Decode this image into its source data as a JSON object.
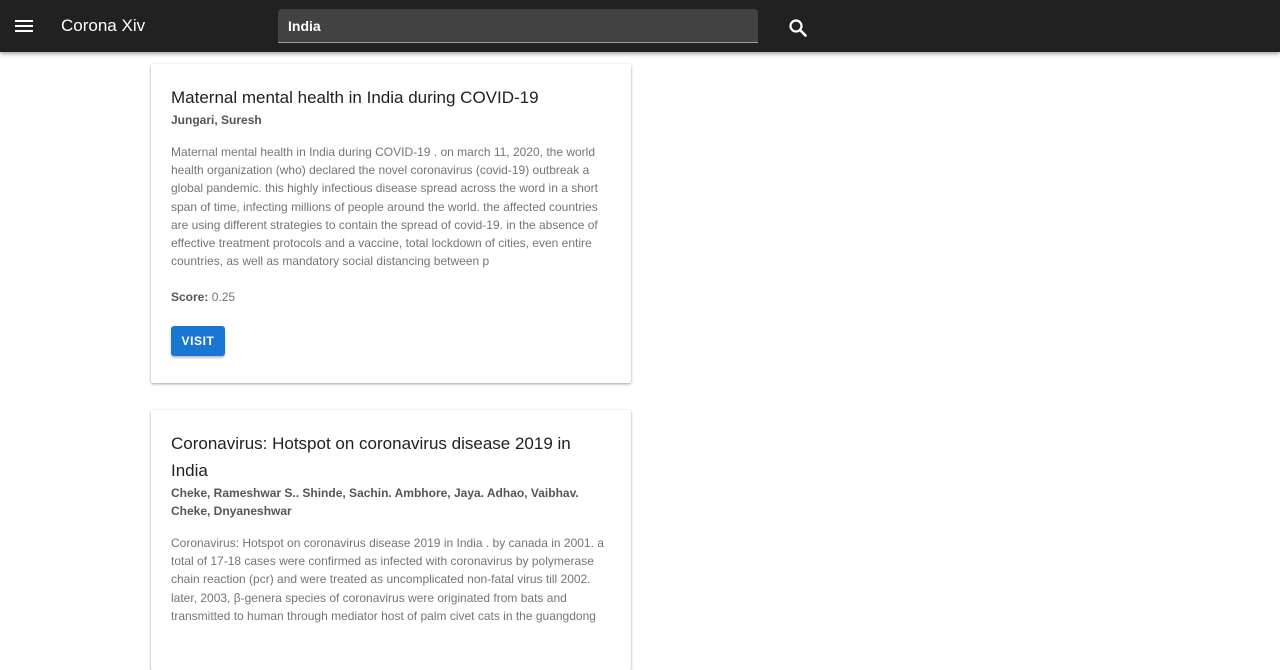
{
  "appbar": {
    "title": "Corona Xiv",
    "menu_icon": "menu-icon",
    "search_icon": "search-icon",
    "background": "#212121"
  },
  "search": {
    "value": "India"
  },
  "results": [
    {
      "title": "Maternal mental health in India during COVID-19",
      "authors": "Jungari, Suresh",
      "abstract": "Maternal mental health in India during COVID-19 . on march 11, 2020, the world health organization (who) declared the novel coronavirus (covid-19) outbreak a global pandemic. this highly infectious disease spread across the word in a short span of time, infecting millions of people around the world. the affected countries are using different strategies to contain the spread of covid-19. in the absence of effective treatment protocols and a vaccine, total lockdown of cities, even entire countries, as well as mandatory social distancing between p",
      "score_label": "Score:",
      "score_value": "0.25",
      "visit_label": "VISIT"
    },
    {
      "title": "Coronavirus: Hotspot on coronavirus disease 2019 in India",
      "authors": "Cheke, Rameshwar S.. Shinde, Sachin. Ambhore, Jaya. Adhao, Vaibhav. Cheke, Dnyaneshwar",
      "abstract": "Coronavirus: Hotspot on coronavirus disease 2019 in India . by canada in 2001. a total of 17-18 cases were confirmed as infected with coronavirus by polymerase chain reaction (pcr) and were treated as uncomplicated non-fatal virus till 2002. later, 2003, β-genera species of coronavirus were originated from bats and transmitted to human through mediator host of palm civet cats in the guangdong"
    }
  ],
  "colors": {
    "accent": "#1976d2"
  }
}
